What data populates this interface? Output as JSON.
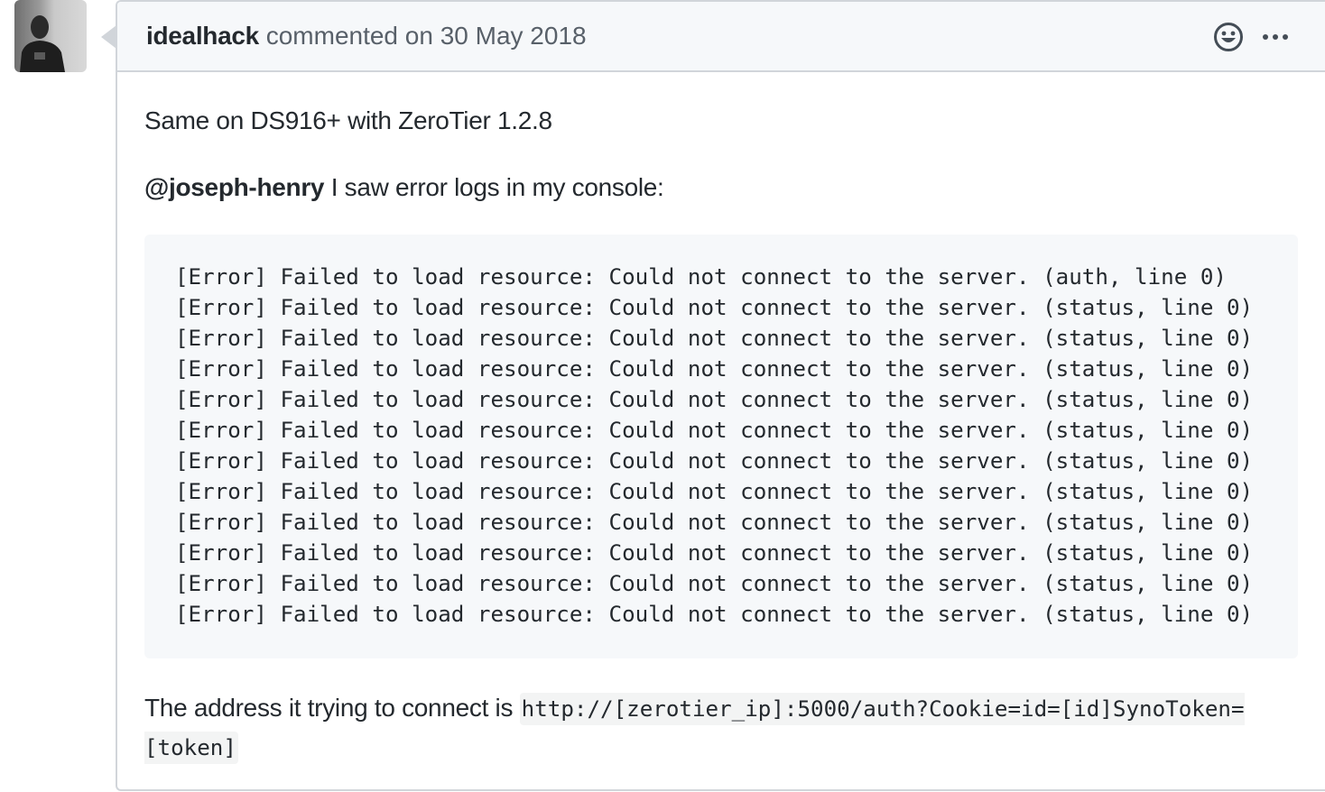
{
  "avatar": {
    "alt": "idealhack avatar"
  },
  "comment": {
    "author": "idealhack",
    "action_text": "commented on 30 May 2018",
    "header_icons": {
      "reaction_icon": "smiley-icon",
      "more_icon": "kebab-horizontal-icon"
    },
    "body": {
      "paragraph1": "Same on DS916+ with ZeroTier 1.2.8",
      "mention": "@joseph-henry",
      "paragraph2_rest": " I saw error logs in my console:",
      "code_lines": [
        "[Error] Failed to load resource: Could not connect to the server. (auth, line 0)",
        "[Error] Failed to load resource: Could not connect to the server. (status, line 0)",
        "[Error] Failed to load resource: Could not connect to the server. (status, line 0)",
        "[Error] Failed to load resource: Could not connect to the server. (status, line 0)",
        "[Error] Failed to load resource: Could not connect to the server. (status, line 0)",
        "[Error] Failed to load resource: Could not connect to the server. (status, line 0)",
        "[Error] Failed to load resource: Could not connect to the server. (status, line 0)",
        "[Error] Failed to load resource: Could not connect to the server. (status, line 0)",
        "[Error] Failed to load resource: Could not connect to the server. (status, line 0)",
        "[Error] Failed to load resource: Could not connect to the server. (status, line 0)",
        "[Error] Failed to load resource: Could not connect to the server. (status, line 0)",
        "[Error] Failed to load resource: Could not connect to the server. (status, line 0)"
      ],
      "paragraph3_text": "The address it trying to connect is",
      "paragraph3_code": "http://[zerotier_ip]:5000/auth?Cookie=id=[id]SynoToken=[token]"
    }
  },
  "colors": {
    "border": "#d1d5da",
    "header_bg": "#f6f8fa",
    "code_bg": "#f6f8fa",
    "text": "#24292e",
    "muted": "#586069"
  }
}
